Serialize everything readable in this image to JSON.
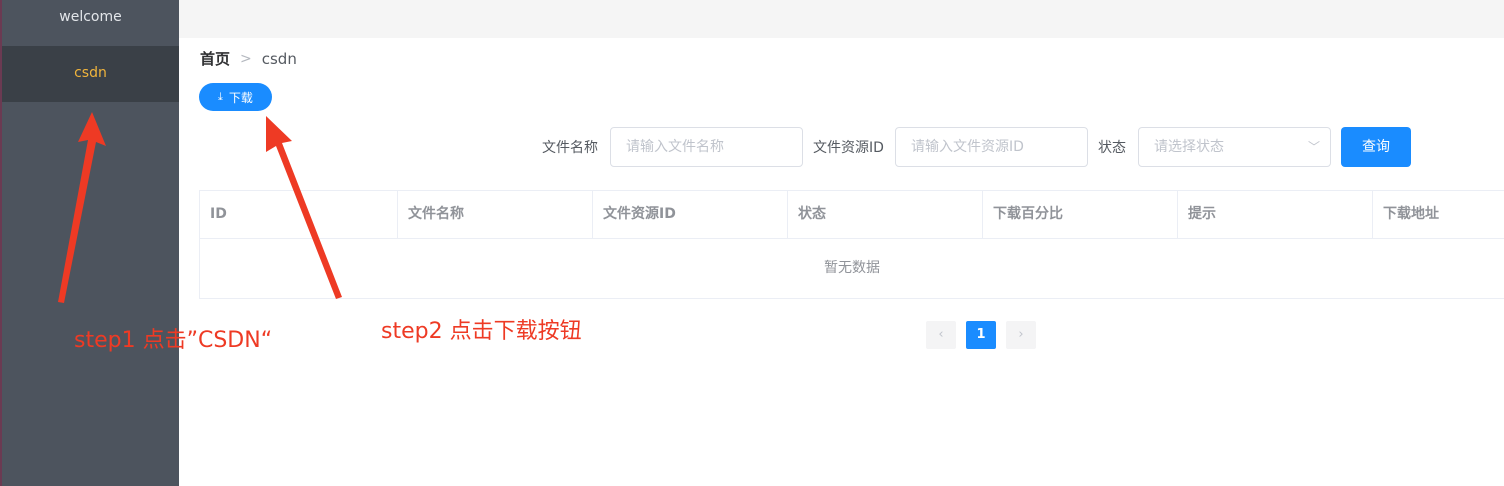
{
  "sidebar": {
    "items": [
      {
        "label": "welcome",
        "active": false
      },
      {
        "label": "csdn",
        "active": true
      }
    ]
  },
  "breadcrumb": {
    "home": "首页",
    "separator": ">",
    "current": "csdn"
  },
  "toolbar": {
    "download_label": "下载",
    "download_icon": "download-icon"
  },
  "search": {
    "file_name_label": "文件名称",
    "file_name_placeholder": "请输入文件名称",
    "resource_id_label": "文件资源ID",
    "resource_id_placeholder": "请输入文件资源ID",
    "status_label": "状态",
    "status_placeholder": "请选择状态",
    "query_label": "查询"
  },
  "table": {
    "columns": [
      "ID",
      "文件名称",
      "文件资源ID",
      "状态",
      "下载百分比",
      "提示",
      "下载地址"
    ],
    "empty_text": "暂无数据"
  },
  "pagination": {
    "prev": "‹",
    "current_page": "1",
    "next": "›"
  },
  "annotations": {
    "step1": "step1 点击”CSDN“",
    "step2": "step2 点击下载按钮"
  },
  "colors": {
    "primary": "#1a8cff",
    "sidebar_bg": "#4d545e",
    "sidebar_active_text": "#f0b43c",
    "annotation": "#ee3a24"
  }
}
